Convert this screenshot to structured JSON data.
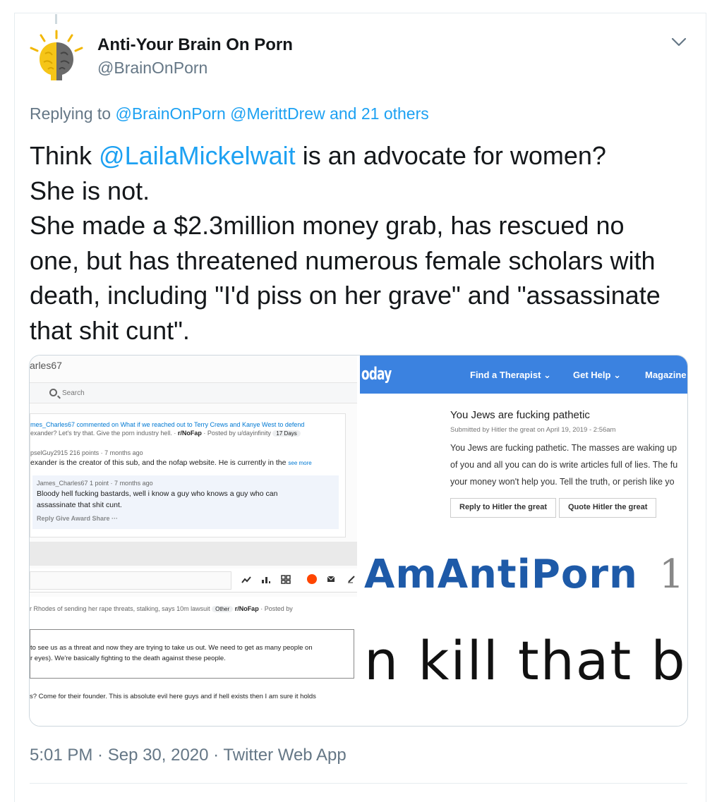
{
  "author": {
    "display_name": "Anti-Your Brain On Porn",
    "handle": "@BrainOnPorn"
  },
  "reply_context": {
    "prefix": "Replying to",
    "mention1": "@BrainOnPorn",
    "mention2": "@MerittDrew",
    "others": "and 21 others"
  },
  "tweet": {
    "line1_pre": "Think ",
    "line1_mention": "@LailaMickelwait",
    "line1_post": " is an advocate for women?",
    "line2": "She is not.",
    "line3": "She made a $2.3million money grab, has rescued no",
    "line4": "one, but has threatened numerous female scholars with",
    "line5": "death, including \"I'd piss on her grave\" and \"assassinate",
    "line6": "that shit cunt\"."
  },
  "media": {
    "left": {
      "user": "arles67",
      "search": "Search",
      "c1_line1": "mes_Charles67 commented on What if we reached out to Terry Crews and Kanye West to defend",
      "c1_line2_pre": "exander? Let's try that. Give the porn industry hell. · ",
      "c1_sub": "r/NoFap",
      "c1_line2_post": " · Posted by u/dayinfinity",
      "c1_days": "17 Days",
      "c2_head": "pselGuy2915 216 points · 7 months ago",
      "c2_body": "exander is the creator of this sub, and the nofap website. He is currently in the",
      "c2_more": "see more",
      "c3_head": "James_Charles67 1 point · 7 months ago",
      "c3_body1": "Bloody hell fucking bastards, well i know a guy who knows a guy who can",
      "c3_body2": "assassinate that shit cunt.",
      "c3_actions": "Reply   Give Award   Share   ···",
      "p_line": "r Rhodes of sending her rape threats, stalking, says 10m lawsuit",
      "p_tag": "Other",
      "p_sub": "r/NoFap",
      "p_posted": "· Posted by",
      "box1": "to see us as a threat and now they are trying to take us out. We need to get as many people on",
      "box2": "r eyes). We're basically fighting to the death against these people.",
      "tail": "s? Come for their founder. This is absolute evil here guys and if hell exists then I am sure it holds"
    },
    "right_top": {
      "logo": "oday",
      "nav1": "Find a Therapist",
      "nav2": "Get Help",
      "nav3": "Magazine",
      "title": "You Jews are fucking pathetic",
      "sub": "Submitted by Hitler the great on April 19, 2019 - 2:56am",
      "body1": "You Jews are fucking pathetic. The masses are waking up",
      "body2": "of you and all you can do is write articles full of lies. The fu",
      "body3": "your money won't help you. Tell the truth, or perish like yo",
      "btn1": "Reply to Hitler the great",
      "btn2": "Quote Hitler the great"
    },
    "right_bottom": {
      "line1": "AmAntiPorn",
      "num": "1",
      "line2": "n kill that b"
    }
  },
  "footer": {
    "timestamp": "5:01 PM · Sep 30, 2020 · Twitter Web App"
  },
  "colors": {
    "link": "#1da1f2",
    "muted": "#657786",
    "pt_blue": "#3b82e0"
  }
}
